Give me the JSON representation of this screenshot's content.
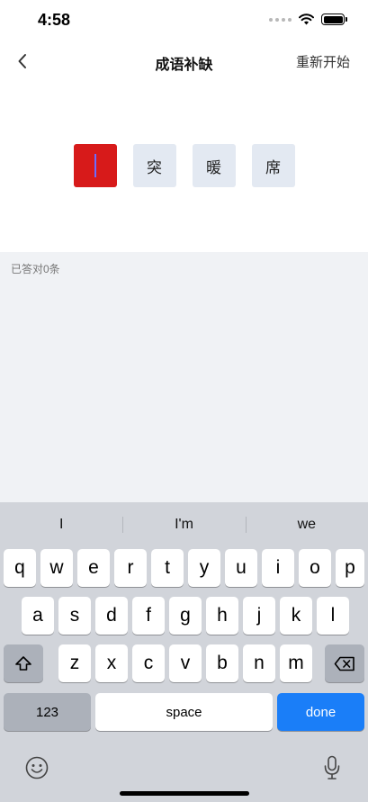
{
  "status": {
    "time": "4:58"
  },
  "nav": {
    "title": "成语补缺",
    "restart_label": "重新开始"
  },
  "idiom": {
    "chars": [
      "",
      "突",
      "暖",
      "席"
    ]
  },
  "answers": {
    "count_text": "已答对0条"
  },
  "keyboard": {
    "suggestions": [
      "I",
      "I'm",
      "we"
    ],
    "row1": [
      "q",
      "w",
      "e",
      "r",
      "t",
      "y",
      "u",
      "i",
      "o",
      "p"
    ],
    "row2": [
      "a",
      "s",
      "d",
      "f",
      "g",
      "h",
      "j",
      "k",
      "l"
    ],
    "row3": [
      "z",
      "x",
      "c",
      "v",
      "b",
      "n",
      "m"
    ],
    "numbers_label": "123",
    "space_label": "space",
    "done_label": "done"
  },
  "colors": {
    "blank_cell": "#d71a1a",
    "char_cell": "#e3e9f2",
    "done_key": "#1a7ef8"
  }
}
